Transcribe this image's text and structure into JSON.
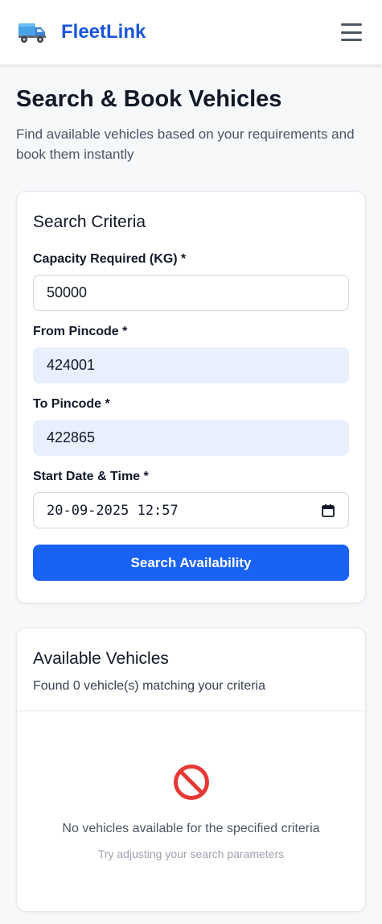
{
  "header": {
    "brand": "FleetLink",
    "logo_icon": "truck-icon",
    "menu_icon": "hamburger-menu-icon"
  },
  "page": {
    "title": "Search & Book Vehicles",
    "subtitle": "Find available vehicles based on your requirements and book them instantly"
  },
  "search": {
    "title": "Search Criteria",
    "capacity_label": "Capacity Required (KG) *",
    "capacity_value": "50000",
    "from_label": "From Pincode *",
    "from_value": "424001",
    "to_label": "To Pincode *",
    "to_value": "422865",
    "start_label": "Start Date & Time *",
    "start_value": "20-09-2025 12:57",
    "submit_label": "Search Availability"
  },
  "results": {
    "title": "Available Vehicles",
    "count_text": "Found 0 vehicle(s) matching your criteria",
    "empty_icon": "no-entry-icon",
    "empty_title": "No vehicles available for the specified criteria",
    "empty_hint": "Try adjusting your search parameters"
  },
  "colors": {
    "brand": "#1a56db",
    "primary_button": "#1a62f5",
    "autofill_bg": "#e8f0fe",
    "empty_icon": "#e53935"
  }
}
